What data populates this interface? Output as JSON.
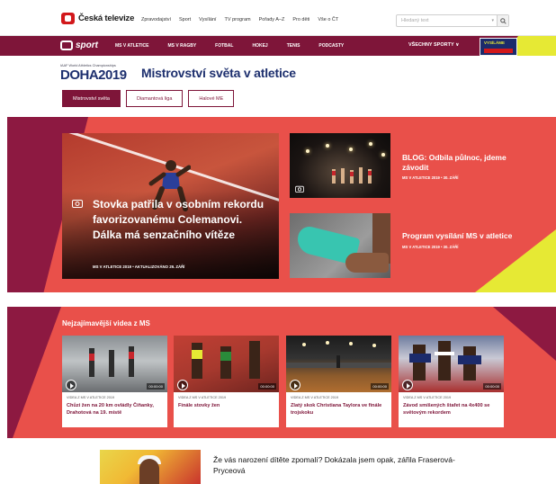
{
  "ct": {
    "brand": "Česká televize",
    "nav": [
      "Zpravodajství",
      "Sport",
      "Vysílání",
      "TV program",
      "Pořady A–Z",
      "Pro děti",
      "Vše o ČT"
    ],
    "search_placeholder": "Hledaný text"
  },
  "sport": {
    "brand": "sport",
    "nav": [
      "MS V ATLETICE",
      "MS V RAGBY",
      "FOTBAL",
      "HOKEJ",
      "TENIS",
      "PODCASTY"
    ],
    "all_sports": "VŠECHNY SPORTY",
    "promo": "VYSÍLÁME"
  },
  "header": {
    "doha_small": "IAAF World Athletics Championships",
    "doha_big": "DOHA2019",
    "title": "Mistrovství světa v atletice",
    "tabs": [
      "Mistrovství světa",
      "Diamantová liga",
      "Halové ME"
    ],
    "active_tab": 0
  },
  "hero": {
    "main": {
      "headline": "Stovka patřila v osobním rekordu favorizovanému Colemanovi. Dálka má senzačního vítěze",
      "meta_prefix": "MS V ATLETICE 2019",
      "meta_updated": "AKTUALIZOVÁNO",
      "meta_date": "29. ZÁŘÍ"
    },
    "side": [
      {
        "title": "BLOG: Odbila půlnoc, jdeme závodit",
        "meta": "MS V ATLETICE 2019 • 30. ZÁŘÍ"
      },
      {
        "title": "Program vysílání MS v atletice",
        "meta": "MS V ATLETICE 2019 • 30. ZÁŘÍ"
      }
    ]
  },
  "videos": {
    "section_title": "Nejzajímavější videa z MS",
    "items": [
      {
        "category": "VIDEA Z MS V ATLETICE 2019",
        "title": "Chůzi žen na 20 km ovládly Číňanky, Drahotová na 19. místě",
        "duration": "00:00:00"
      },
      {
        "category": "VIDEA Z MS V ATLETICE 2019",
        "title": "Finále stovky žen",
        "duration": "00:00:00"
      },
      {
        "category": "VIDEA Z MS V ATLETICE 2019",
        "title": "Zlatý skok Christiana Taylora ve finále trojskoku",
        "duration": "00:00:00"
      },
      {
        "category": "VIDEA Z MS V ATLETICE 2019",
        "title": "Závod smíšených štafet na 4x400 se světovým rekordem",
        "duration": "00:00:00"
      }
    ]
  },
  "bottom": {
    "title": "Že vás narození dítěte zpomalí? Dokázala jsem opak, zářila Fraserová-Pryceová"
  },
  "colors": {
    "ct_red": "#d2181b",
    "sport_maroon": "#7e1539",
    "hero_coral": "#e9504a",
    "accent_yellow": "#e6e934",
    "doha_blue": "#1d2f6e"
  }
}
